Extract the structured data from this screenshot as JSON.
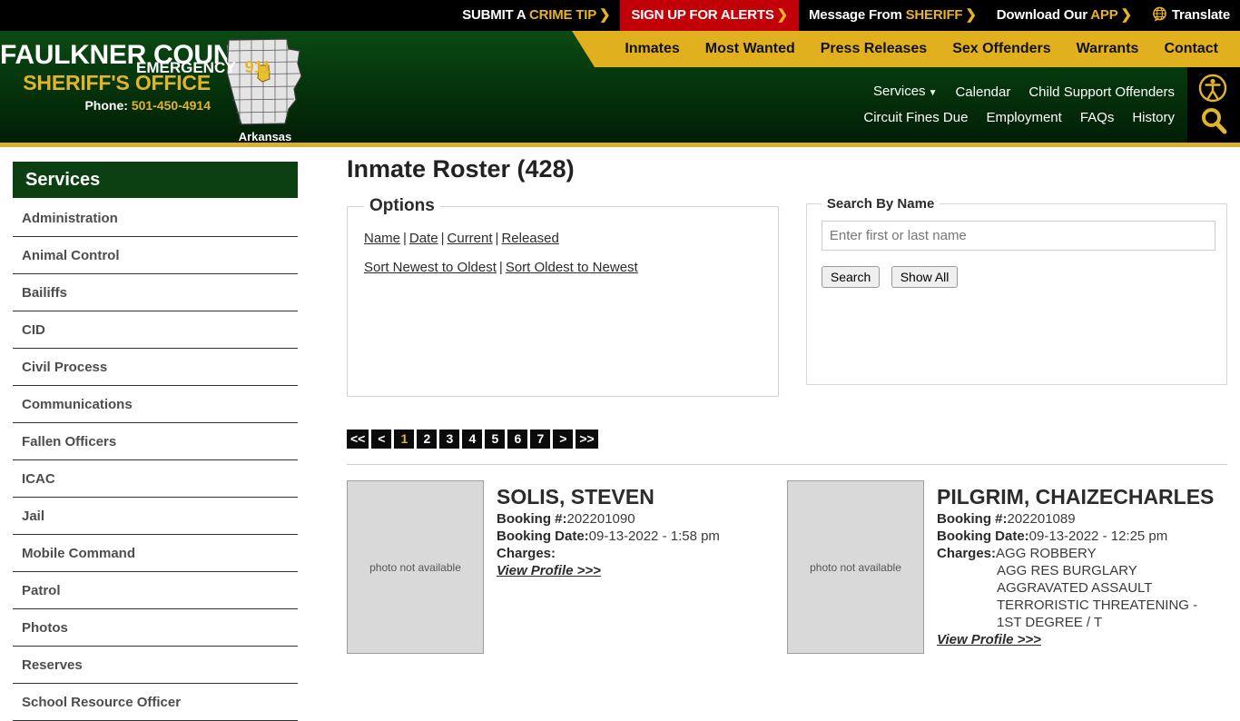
{
  "topbar": {
    "items": [
      {
        "name": "submit-crime-tip",
        "pre": "SUBMIT A ",
        "hl": "CRIME TIP",
        "chevron": "❯",
        "style": "plain"
      },
      {
        "name": "sign-up-alerts",
        "pre": "SIGN UP FOR ALERTS",
        "hl": "",
        "chevron": "❯",
        "style": "alerts"
      },
      {
        "name": "message-from-sheriff",
        "pre": "Message From ",
        "hl": "SHERIFF",
        "chevron": "❯",
        "style": "plain"
      },
      {
        "name": "download-app",
        "pre": "Download Our ",
        "hl": "APP",
        "chevron": "❯",
        "style": "plain"
      },
      {
        "name": "translate",
        "pre": "Translate",
        "hl": "",
        "chevron": "",
        "style": "translate"
      }
    ]
  },
  "header": {
    "county": "FAULKNER COUNTY",
    "office": "SHERIFF'S OFFICE",
    "phone_label": "Phone:",
    "phone_number": "501-450-4914",
    "map_label": "Arkansas",
    "emergency_label": "EMERGENCY",
    "emergency_number": "911",
    "gold_nav": [
      "Inmates",
      "Most Wanted",
      "Press Releases",
      "Sex Offenders",
      "Warrants",
      "Contact"
    ],
    "sub_nav_row1": [
      "Services",
      "Calendar",
      "Child Support Offenders"
    ],
    "sub_nav_row2": [
      "Circuit Fines Due",
      "Employment",
      "FAQs",
      "History"
    ],
    "colors": {
      "gold": "#e0b01f",
      "green": "#05360c",
      "alert_red": "#c20008",
      "black": "#000000"
    }
  },
  "sidebar": {
    "heading": "Services",
    "items": [
      "Administration",
      "Animal Control",
      "Bailiffs",
      "CID",
      "Civil Process",
      "Communications",
      "Fallen Officers",
      "ICAC",
      "Jail",
      "Mobile Command",
      "Patrol",
      "Photos",
      "Reserves",
      "School Resource Officer"
    ]
  },
  "main": {
    "page_title": "Inmate Roster (428)",
    "options": {
      "legend": "Options",
      "row1": [
        "Name",
        "Date",
        "Current",
        "Released"
      ],
      "row2": [
        "Sort Newest to Oldest",
        "Sort Oldest to Newest"
      ],
      "separator": "|"
    },
    "search": {
      "legend": "Search By Name",
      "placeholder": "Enter first or last name",
      "value": "",
      "search_label": "Search",
      "show_all_label": "Show All"
    },
    "pagination": {
      "items": [
        "<<",
        "<",
        "1",
        "2",
        "3",
        "4",
        "5",
        "6",
        "7",
        ">",
        ">>"
      ],
      "active": "1"
    },
    "roster": [
      {
        "name": "SOLIS, STEVEN",
        "photo_text": "photo not available",
        "booking_label": "Booking #:",
        "booking_number": "202201090",
        "date_label": "Booking Date:",
        "booking_date": "09-13-2022 - 1:58 pm",
        "charges_label": "Charges:",
        "charges_first": "",
        "charges_rest": [],
        "view_profile": "View Profile >>>"
      },
      {
        "name": "PILGRIM, CHAIZECHARLES",
        "photo_text": "photo not available",
        "booking_label": "Booking #:",
        "booking_number": "202201089",
        "date_label": "Booking Date:",
        "booking_date": "09-13-2022 - 12:25 pm",
        "charges_label": "Charges:",
        "charges_first": "AGG ROBBERY",
        "charges_rest": [
          "AGG RES BURGLARY",
          "AGGRAVATED ASSAULT",
          "TERRORISTIC THREATENING -",
          "1ST DEGREE / T"
        ],
        "view_profile": "View Profile >>>"
      }
    ]
  }
}
